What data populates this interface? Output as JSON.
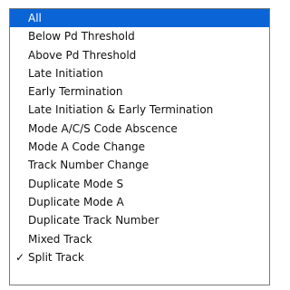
{
  "menu": {
    "items": [
      {
        "label": "All",
        "state": "highlighted"
      },
      {
        "label": "Below Pd Threshold"
      },
      {
        "label": "Above Pd Threshold"
      },
      {
        "label": "Late Initiation"
      },
      {
        "label": "Early Termination"
      },
      {
        "label": "Late Initiation & Early Termination"
      },
      {
        "label": "Mode A/C/S Code Abscence"
      },
      {
        "label": "Mode A Code Change"
      },
      {
        "label": "Track Number Change"
      },
      {
        "label": "Duplicate Mode S"
      },
      {
        "label": "Duplicate Mode A"
      },
      {
        "label": "Duplicate Track Number"
      },
      {
        "label": "Mixed Track"
      },
      {
        "label": "Split Track",
        "checked": true,
        "check_glyph": "✓"
      }
    ],
    "colors": {
      "highlight_bg": "#0a64d6",
      "highlight_text": "#ffffff",
      "text": "#111111",
      "border": "#7a7a7a"
    },
    "icons": {
      "checkmark": "check-icon"
    }
  }
}
